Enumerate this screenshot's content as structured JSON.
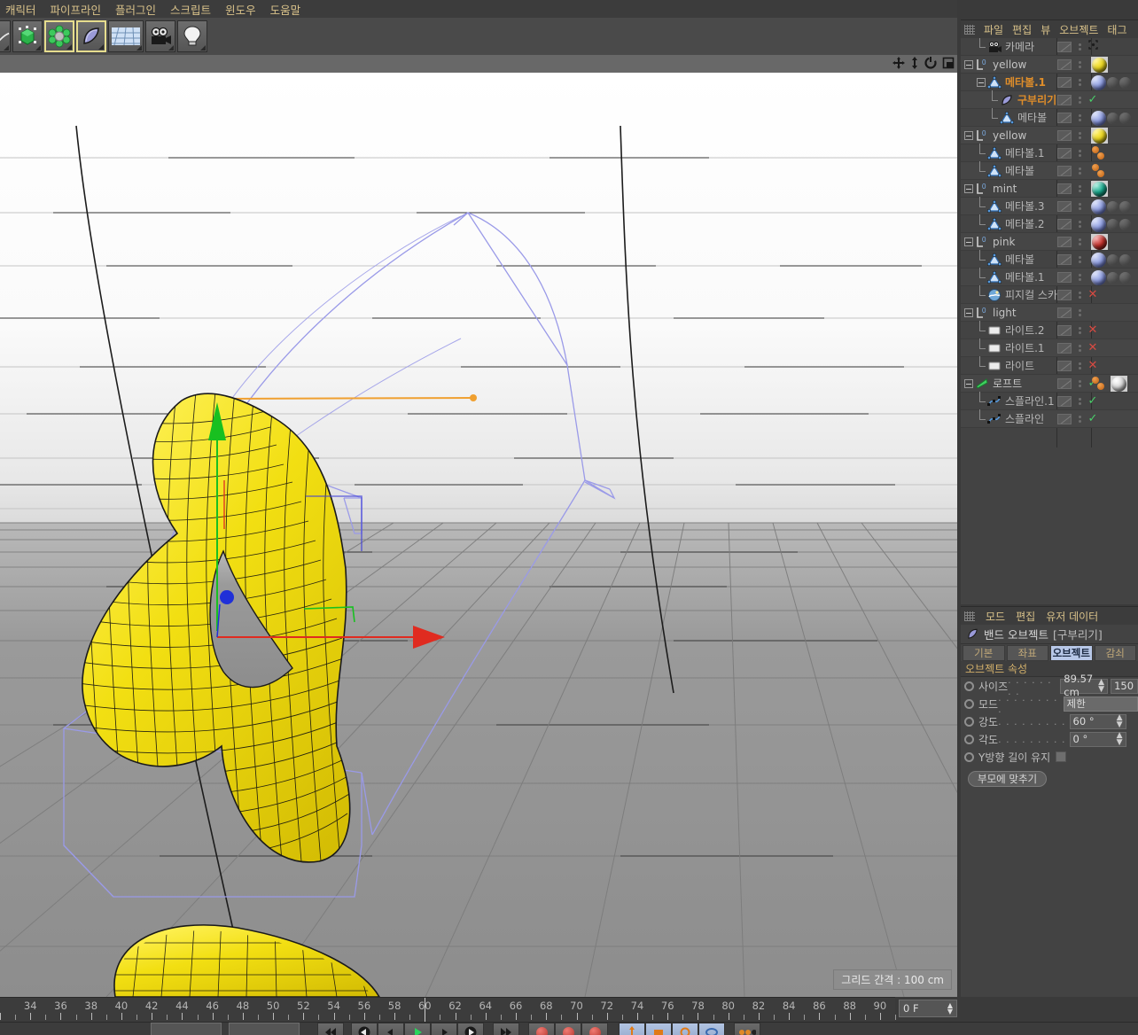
{
  "menubar": {
    "items": [
      "캐릭터",
      "파이프라인",
      "플러그인",
      "스크립트",
      "윈도우",
      "도움말"
    ]
  },
  "toolbar": {
    "buttons": [
      {
        "name": "primitive-cube-tool",
        "label": "큐브"
      },
      {
        "name": "metaball-tool",
        "label": "메타볼",
        "selected": true
      },
      {
        "name": "bend-deformer-tool",
        "label": "구부리기",
        "selected": true
      },
      {
        "name": "floor-environment-tool",
        "label": "환경"
      },
      {
        "name": "camera-tool",
        "label": "카메라"
      },
      {
        "name": "light-tool",
        "label": "라이트"
      }
    ]
  },
  "viewport": {
    "grid_label": "그리드 간격 : 100 cm",
    "nav_icons": [
      "move-icon",
      "scale-icon",
      "rotate-icon",
      "maximize-icon"
    ]
  },
  "object_manager": {
    "menu": [
      "파일",
      "편집",
      "뷰",
      "오브젝트",
      "태그"
    ],
    "rows": [
      {
        "label": "카메라",
        "icon": "camera-icon",
        "depth": 1,
        "expander": false,
        "selected": false,
        "tag": "target",
        "mats": []
      },
      {
        "label": "yellow",
        "icon": "null-object-icon",
        "depth": 0,
        "expander": true,
        "selected": false,
        "tag": "",
        "mats": [
          "yellow-material"
        ]
      },
      {
        "label": "메타볼.1",
        "icon": "metaball-icon",
        "depth": 1,
        "expander": true,
        "selected": true,
        "tag": "",
        "mats": [
          "blue-s-material",
          "ghost-material"
        ]
      },
      {
        "label": "구부리기",
        "icon": "bend-deformer-icon",
        "depth": 2,
        "expander": false,
        "selected": true,
        "tag": "check",
        "mats": []
      },
      {
        "label": "메타볼",
        "icon": "metaball-icon",
        "depth": 2,
        "expander": false,
        "selected": false,
        "tag": "",
        "mats": [
          "blue-s-material",
          "ghost-material"
        ]
      },
      {
        "label": "yellow",
        "icon": "null-object-icon",
        "depth": 0,
        "expander": true,
        "selected": false,
        "tag": "",
        "mats": [
          "yellow-material"
        ]
      },
      {
        "label": "메타볼.1",
        "icon": "metaball-icon",
        "depth": 1,
        "expander": false,
        "selected": false,
        "tag": "",
        "mats": [
          "orange-dots-material"
        ]
      },
      {
        "label": "메타볼",
        "icon": "metaball-icon",
        "depth": 1,
        "expander": false,
        "selected": false,
        "tag": "",
        "mats": [
          "orange-dots-material"
        ]
      },
      {
        "label": "mint",
        "icon": "null-object-icon",
        "depth": 0,
        "expander": true,
        "selected": false,
        "tag": "",
        "mats": [
          "mint-material"
        ]
      },
      {
        "label": "메타볼.3",
        "icon": "metaball-icon",
        "depth": 1,
        "expander": false,
        "selected": false,
        "tag": "",
        "mats": [
          "blue-s-material",
          "ghost-material"
        ]
      },
      {
        "label": "메타볼.2",
        "icon": "metaball-icon",
        "depth": 1,
        "expander": false,
        "selected": false,
        "tag": "",
        "mats": [
          "blue-s-material",
          "ghost-material"
        ]
      },
      {
        "label": "pink",
        "icon": "null-object-icon",
        "depth": 0,
        "expander": true,
        "selected": false,
        "tag": "",
        "mats": [
          "pink-material"
        ]
      },
      {
        "label": "메타볼",
        "icon": "metaball-icon",
        "depth": 1,
        "expander": false,
        "selected": false,
        "tag": "",
        "mats": [
          "blue-s-material",
          "ghost-material"
        ]
      },
      {
        "label": "메타볼.1",
        "icon": "metaball-icon",
        "depth": 1,
        "expander": false,
        "selected": false,
        "tag": "",
        "mats": [
          "blue-s-material",
          "ghost-material"
        ]
      },
      {
        "label": "피지컬 스카이",
        "icon": "physical-sky-icon",
        "depth": 1,
        "expander": false,
        "selected": false,
        "tag": "x",
        "mats": []
      },
      {
        "label": "light",
        "icon": "null-object-icon",
        "depth": 0,
        "expander": true,
        "selected": false,
        "tag": "",
        "mats": []
      },
      {
        "label": "라이트.2",
        "icon": "light-icon",
        "depth": 1,
        "expander": false,
        "selected": false,
        "tag": "x",
        "mats": []
      },
      {
        "label": "라이트.1",
        "icon": "light-icon",
        "depth": 1,
        "expander": false,
        "selected": false,
        "tag": "x",
        "mats": []
      },
      {
        "label": "라이트",
        "icon": "light-icon",
        "depth": 1,
        "expander": false,
        "selected": false,
        "tag": "x",
        "mats": []
      },
      {
        "label": "로프트",
        "icon": "loft-nurbs-icon",
        "depth": 0,
        "expander": true,
        "selected": false,
        "tag": "check",
        "mats": [
          "orange-dots-material",
          "white-material"
        ]
      },
      {
        "label": "스플라인.1",
        "icon": "spline-icon",
        "depth": 1,
        "expander": false,
        "selected": false,
        "tag": "check",
        "mats": []
      },
      {
        "label": "스플라인",
        "icon": "spline-icon",
        "depth": 1,
        "expander": false,
        "selected": false,
        "tag": "check",
        "mats": []
      }
    ]
  },
  "attribute_manager": {
    "menu": [
      "모드",
      "편집",
      "유저 데이터"
    ],
    "title": "밴드 오브젝트",
    "title_bracket": "[구부리기]",
    "tabs": [
      {
        "label": "기본",
        "active": false
      },
      {
        "label": "좌표",
        "active": false
      },
      {
        "label": "오브젝트",
        "active": true
      },
      {
        "label": "감쇠",
        "active": false
      }
    ],
    "section_header": "오브젝트 속성",
    "properties": [
      {
        "name": "size",
        "label": "사이즈",
        "dots": ". . . . . . . .",
        "type": "number",
        "value": "89.57 cm",
        "value2": "150"
      },
      {
        "name": "mode",
        "label": "모드",
        "dots": ". . . . . . . . .",
        "type": "combo",
        "value": "제한"
      },
      {
        "name": "strength",
        "label": "강도",
        "dots": ". . . . . . . . .",
        "type": "number",
        "value": "60 °"
      },
      {
        "name": "angle",
        "label": "각도",
        "dots": ". . . . . . . . .",
        "type": "number",
        "value": "0 °"
      },
      {
        "name": "keep-y-axis-length",
        "label": "Y방향 길이 유지",
        "dots": "",
        "type": "checkbox",
        "value": ""
      }
    ],
    "button": "부모에 맞추기"
  },
  "timeline": {
    "labels": [
      34,
      36,
      38,
      40,
      42,
      44,
      46,
      48,
      50,
      52,
      54,
      56,
      58,
      60,
      62,
      64,
      66,
      68,
      70,
      72,
      74,
      76,
      78,
      80,
      82,
      84,
      86,
      88,
      90
    ],
    "start": 32,
    "end": 91,
    "current_frame": "0 F",
    "playhead": 60
  },
  "colors": {
    "accent_selected": "#e08e2a",
    "menu_text": "#d9c28a",
    "tab_active_bg": "#b8c8e8",
    "metaball_yellow": "#e8d81e",
    "axis_x": "#e02b20",
    "axis_y": "#18c020",
    "axis_z": "#2030d8",
    "spline_purple": "#9a9ae8",
    "tag_check": "#49d06a",
    "tag_x": "#d94b42"
  }
}
